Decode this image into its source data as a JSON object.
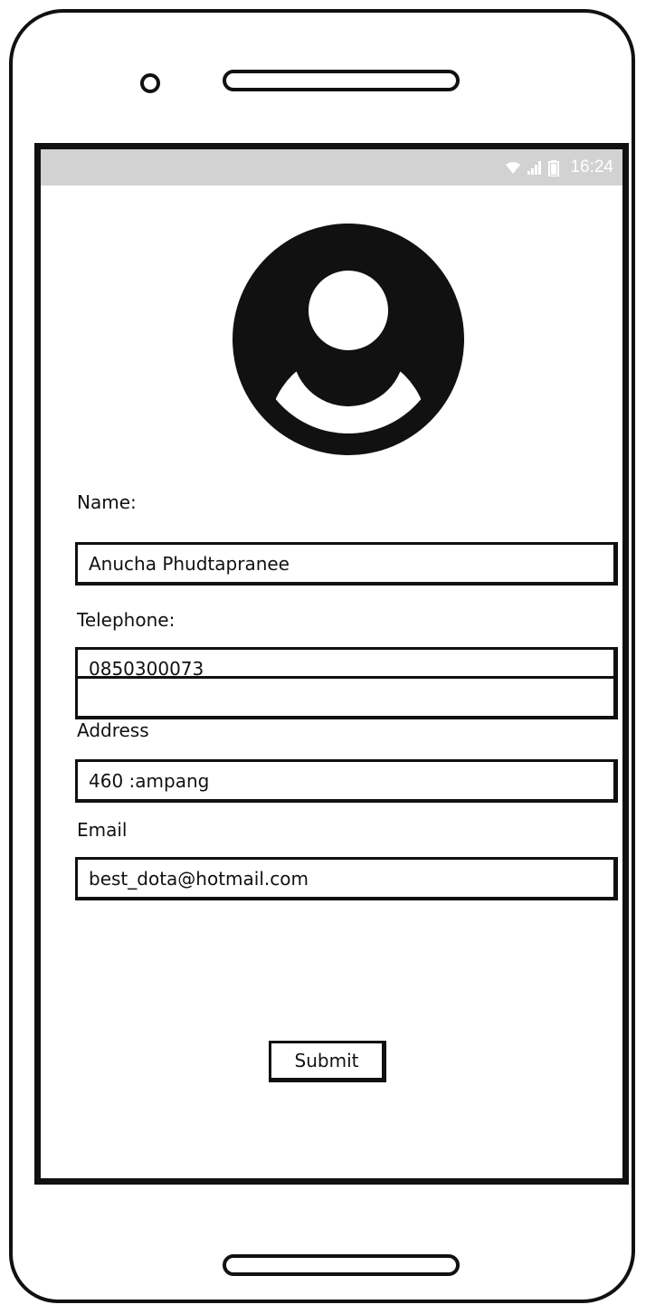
{
  "status_bar": {
    "time": "16:24",
    "icons": [
      "wifi-icon",
      "signal-icon",
      "battery-icon"
    ],
    "background": "#d2d2d2"
  },
  "profile": {
    "avatar_icon": "user-avatar-icon"
  },
  "form": {
    "name_label": "Name:",
    "name_value": "Anucha Phudtapranee",
    "telephone_label": "Telephone:",
    "telephone_value": "0850300073",
    "address_label": "Address",
    "address_value": "460 :ampang",
    "email_label": "Email",
    "email_value": "best_dota@hotmail.com",
    "submit_label": "Submit"
  }
}
